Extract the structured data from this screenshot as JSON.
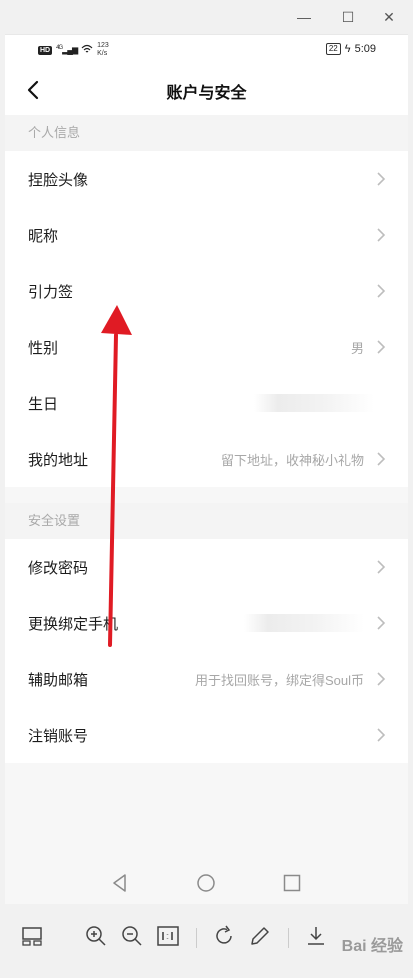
{
  "status": {
    "network": "HD",
    "signal": "4G",
    "speed_value": "123",
    "speed_unit": "K/s",
    "battery": "22",
    "time": "5:09"
  },
  "nav": {
    "title": "账户与安全"
  },
  "sections": [
    {
      "header": "个人信息",
      "items": [
        {
          "label": "捏脸头像",
          "value": ""
        },
        {
          "label": "昵称",
          "value": ""
        },
        {
          "label": "引力签",
          "value": ""
        },
        {
          "label": "性别",
          "value": "男"
        },
        {
          "label": "生日",
          "value": ""
        },
        {
          "label": "我的地址",
          "value": "留下地址，收神秘小礼物"
        }
      ]
    },
    {
      "header": "安全设置",
      "items": [
        {
          "label": "修改密码",
          "value": ""
        },
        {
          "label": "更换绑定手机",
          "value": ""
        },
        {
          "label": "辅助邮箱",
          "value": "用于找回账号，绑定得Soul币"
        },
        {
          "label": "注销账号",
          "value": ""
        }
      ]
    }
  ],
  "watermark": "Bai 经验",
  "colors": {
    "arrow": "#e01b24",
    "text": "#1c1c1c",
    "muted": "#a7a7a7"
  }
}
